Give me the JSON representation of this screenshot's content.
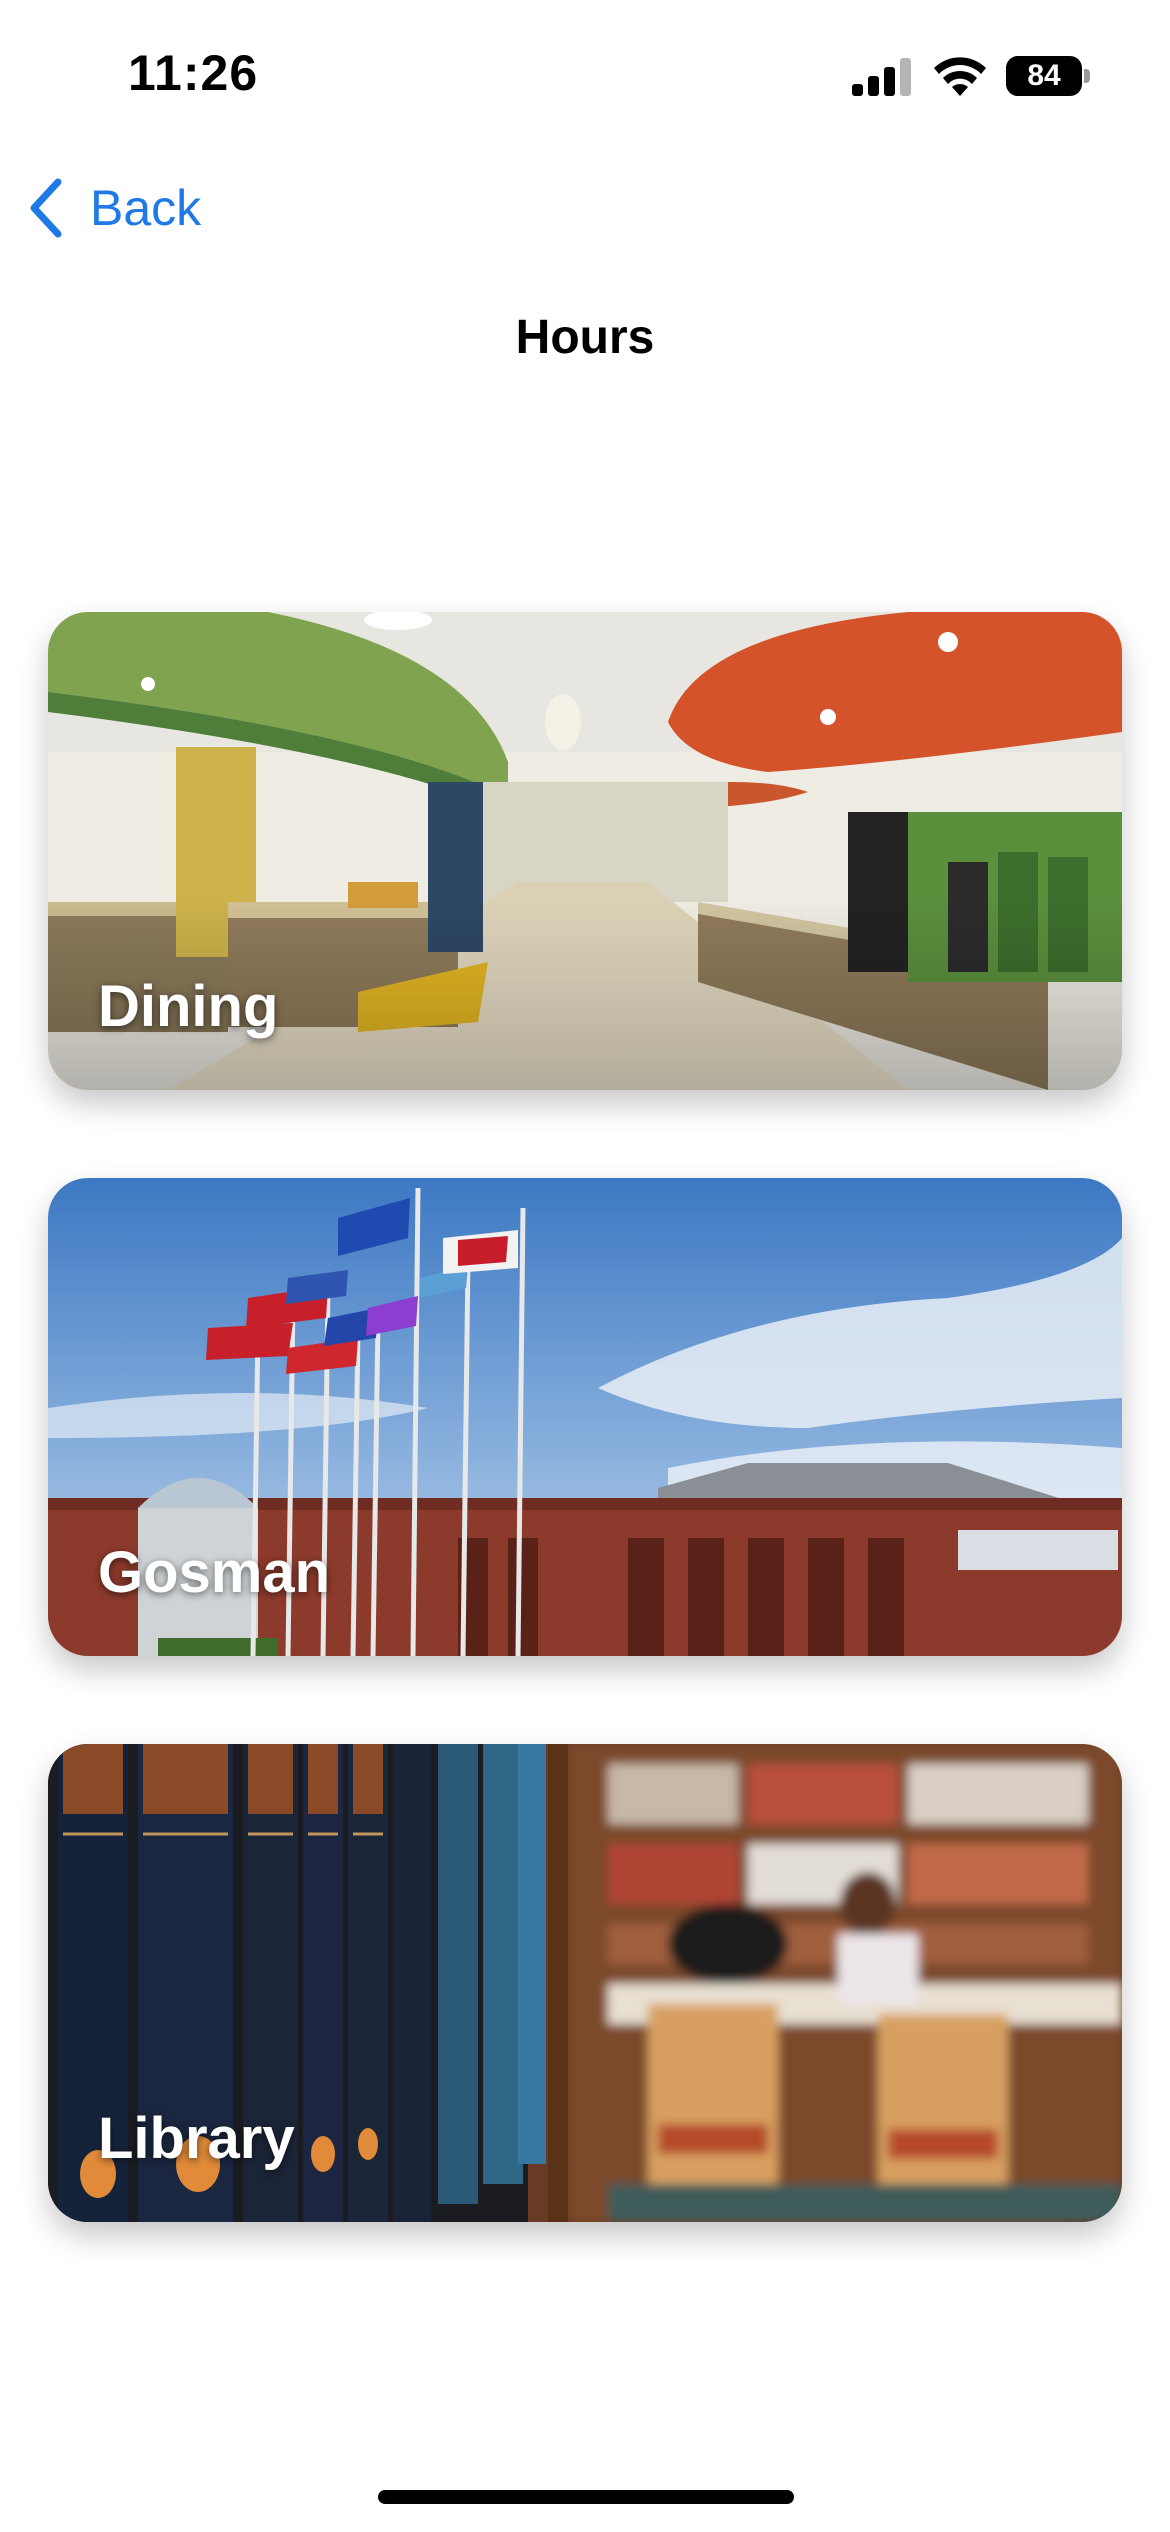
{
  "status_bar": {
    "time": "11:26",
    "battery_level": "84",
    "icons": [
      "cellular-signal-icon",
      "wifi-icon",
      "battery-icon"
    ]
  },
  "nav": {
    "back_label": "Back",
    "back_icon": "chevron-left-icon",
    "title": "Hours"
  },
  "cards": [
    {
      "label": "Dining",
      "image": "dining-hall-photo"
    },
    {
      "label": "Gosman",
      "image": "gosman-building-flags-photo"
    },
    {
      "label": "Library",
      "image": "library-bookshelves-photo"
    }
  ],
  "colors": {
    "accent": "#1f7ae8",
    "background": "#ffffff",
    "text": "#000000"
  }
}
